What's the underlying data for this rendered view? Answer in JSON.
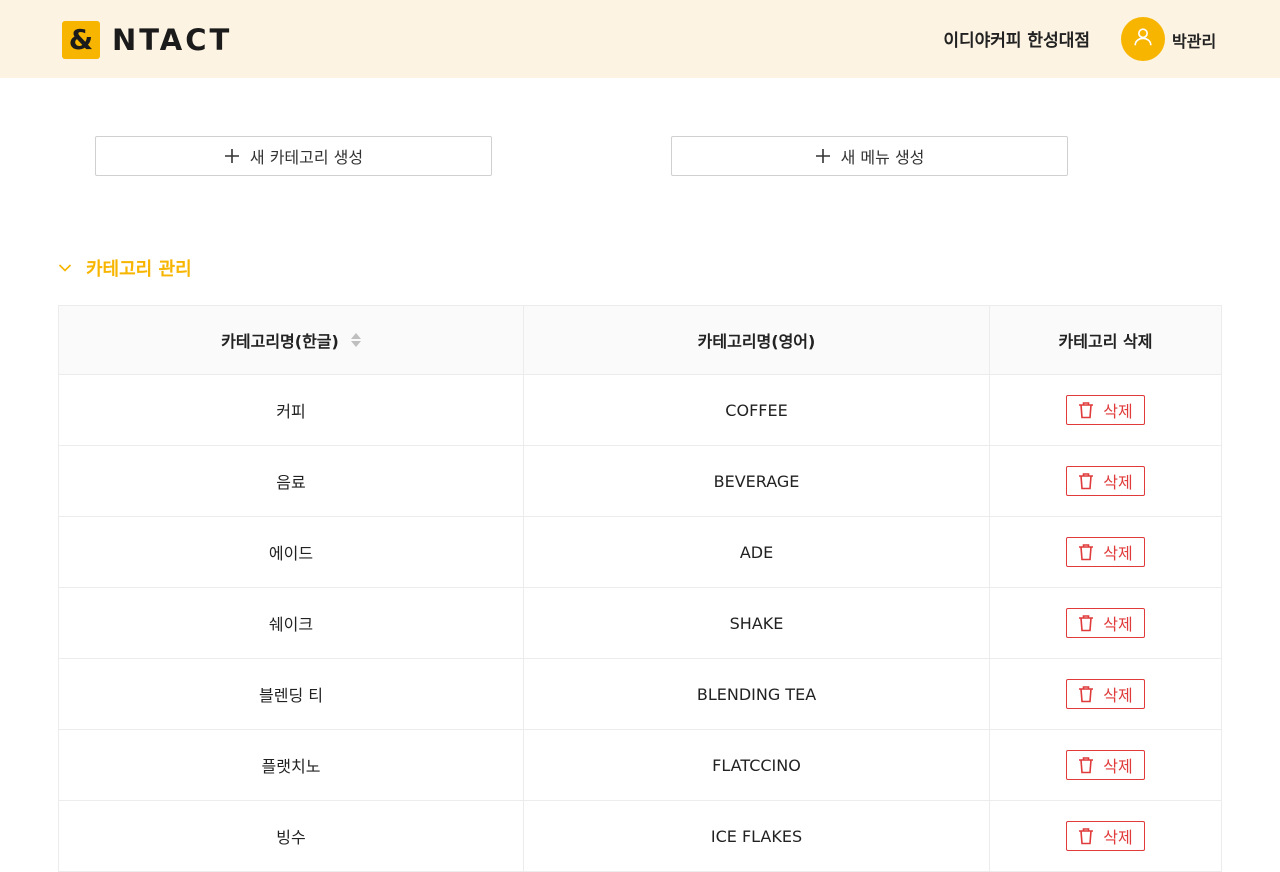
{
  "header": {
    "logo_mark": "&",
    "logo_text": "NTACT",
    "store_name": "이디야커피 한성대점",
    "user_name": "박관리",
    "avatar_icon": "user-icon"
  },
  "actions": {
    "new_category_label": "새 카테고리 생성",
    "new_menu_label": "새 메뉴 생성"
  },
  "section": {
    "title": "카테고리 관리",
    "expanded": true
  },
  "table": {
    "headers": [
      "카테고리명(한글)",
      "카테고리명(영어)",
      "카테고리 삭제"
    ],
    "delete_label": "삭제",
    "rows": [
      {
        "ko": "커피",
        "en": "COFFEE"
      },
      {
        "ko": "음료",
        "en": "BEVERAGE"
      },
      {
        "ko": "에이드",
        "en": "ADE"
      },
      {
        "ko": "쉐이크",
        "en": "SHAKE"
      },
      {
        "ko": "블렌딩 티",
        "en": "BLENDING TEA"
      },
      {
        "ko": "플랫치노",
        "en": "FLATCCINO"
      },
      {
        "ko": "빙수",
        "en": "ICE FLAKES"
      }
    ]
  },
  "colors": {
    "accent": "#f7b500",
    "header_bg": "#fdf3e2",
    "danger": "#e03a3a"
  }
}
